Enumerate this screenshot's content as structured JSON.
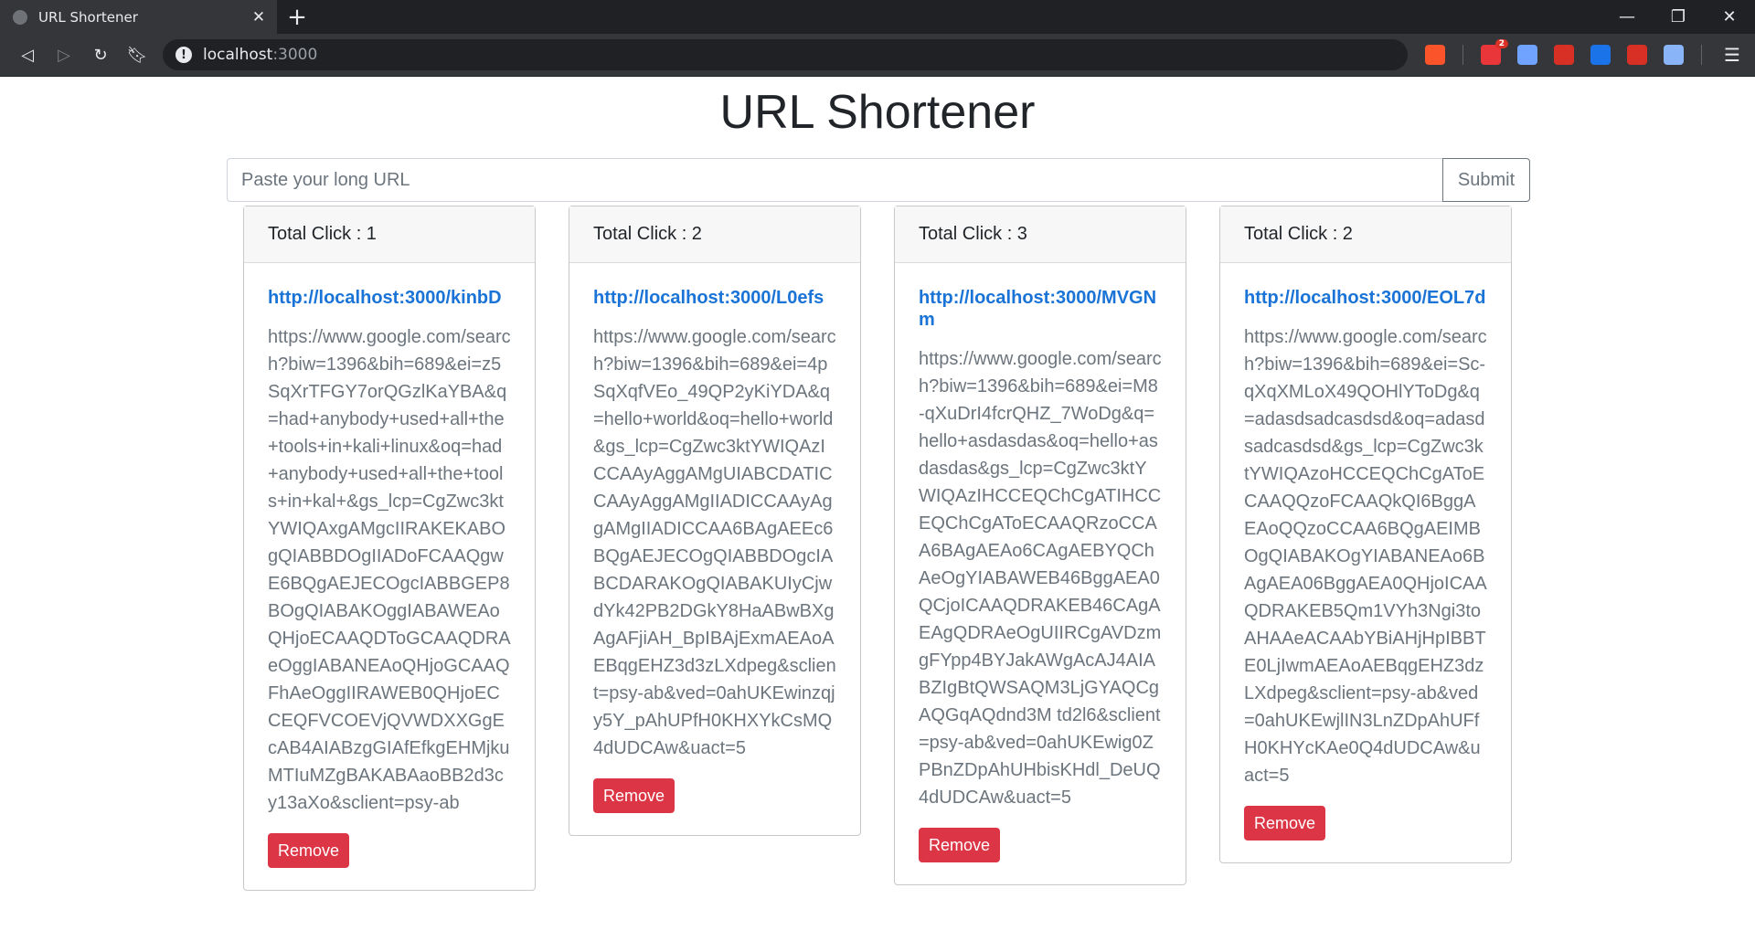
{
  "browser": {
    "tab_title": "URL Shortener",
    "address_host": "localhost",
    "address_port": ":3000",
    "extensions": [
      {
        "name": "brave-icon",
        "color": "#fb542b"
      },
      {
        "name": "brave-rewards-icon",
        "color": "#e8363b",
        "badge": "2"
      },
      {
        "name": "disable-icon",
        "color": "#6fa3ff"
      },
      {
        "name": "pdf-icon",
        "color": "#d93025"
      },
      {
        "name": "s-extension-icon",
        "color": "#1a73e8"
      },
      {
        "name": "adblock-icon",
        "color": "#d93025"
      },
      {
        "name": "globe-extension-icon",
        "color": "#8ab4f8"
      }
    ]
  },
  "page": {
    "title": "URL Shortener",
    "input_placeholder": "Paste your long URL",
    "submit_label": "Submit",
    "remove_label": "Remove",
    "accent_color": "#1a73d6",
    "danger_color": "#dc3545"
  },
  "cards": [
    {
      "header": "Total Click : 1",
      "short_url": "http://localhost:3000/kinbD",
      "long_url": "https://www.google.com/search?biw=1396&bih=689&ei=z5SqXrTFGY7orQGzlKaYBA&q=had+anybody+used+all+the+tools+in+kali+linux&oq=had+anybody+used+all+the+tools+in+kal+&gs_lcp=CgZwc3ktYWIQAxgAMgcIIRAKEKABOgQIABBDOgIIADoFCAAQgwE6BQgAEJECOgcIABBGEP8BOgQIABAKOggIABAWEAoQHjoECAAQDToGCAAQDRAeOggIABANEAoQHjoGCAAQFhAeOggIIRAWEB0QHjoECCEQFVCOEVjQVWDXXGgEcAB4AIABzgGIAfEfkgEHMjkuMTIuMZgBAKABAaoBB2d3cy13aXo&sclient=psy-ab"
    },
    {
      "header": "Total Click : 2",
      "short_url": "http://localhost:3000/L0efs",
      "long_url": "https://www.google.com/search?biw=1396&bih=689&ei=4pSqXqfVEo_49QP2yKiYDA&q=hello+world&oq=hello+world&gs_lcp=CgZwc3ktYWIQAzICCAAyAggAMgUIABCDATICCAAyAggAMgIIADICCAAyAggAMgIIADICCAA6BAgAEEc6BQgAEJECOgQIABBDOgcIABCDARAKOgQIABAKUIyCjwdYk42PB2DGkY8HaABwBXgAgAFjiAH_BpIBAjExmAEAoAEBqgEHZ3d3zLXdpeg&sclient=psy-ab&ved=0ahUKEwinzqjy5Y_pAhUPfH0KHXYkCsMQ4dUDCAw&uact=5"
    },
    {
      "header": "Total Click : 3",
      "short_url": "http://localhost:3000/MVGNm",
      "long_url": "https://www.google.com/search?biw=1396&bih=689&ei=M8-qXuDrI4fcrQHZ_7WoDg&q=hello+asdasdas&oq=hello+asdasdas&gs_lcp=CgZwc3ktYWIQAzIHCCEQChCgATIHCCEQChCgAToECAAQRzoCCAA6BAgAEAo6CAgAEBYQChAeOgYIABAWEB46BggAEA0QCjoICAAQDRAKEB46CAgAEAgQDRAeOgUIIRCgAVDzmgFYpp4BYJakAWgAcAJ4AIABZIgBtQWSAQM3LjGYAQCgAQGqAQdnd3M td2l6&sclient=psy-ab&ved=0ahUKEwig0ZPBnZDpAhUHbisKHdl_DeUQ4dUDCAw&uact=5"
    },
    {
      "header": "Total Click : 2",
      "short_url": "http://localhost:3000/EOL7d",
      "long_url": "https://www.google.com/search?biw=1396&bih=689&ei=Sc-qXqXMLoX49QOHlYToDg&q=adasdsadcasdsd&oq=adasdsadcasdsd&gs_lcp=CgZwc3ktYWIQAzoHCCEQChCgAToECAAQQzoFCAAQkQI6BggAEAoQQzoCCAA6BQgAEIMBOgQIABAKOgYIABANEAo6BAgAEA06BggAEA0QHjoICAAQDRAKEB5Qm1VYh3Ngi3toAHAAeACAAbYBiAHjHpIBBTE0LjIwmAEAoAEBqgEHZ3dzLXdpeg&sclient=psy-ab&ved=0ahUKEwjlIN3LnZDpAhUFfH0KHYcKAe0Q4dUDCAw&uact=5"
    }
  ]
}
